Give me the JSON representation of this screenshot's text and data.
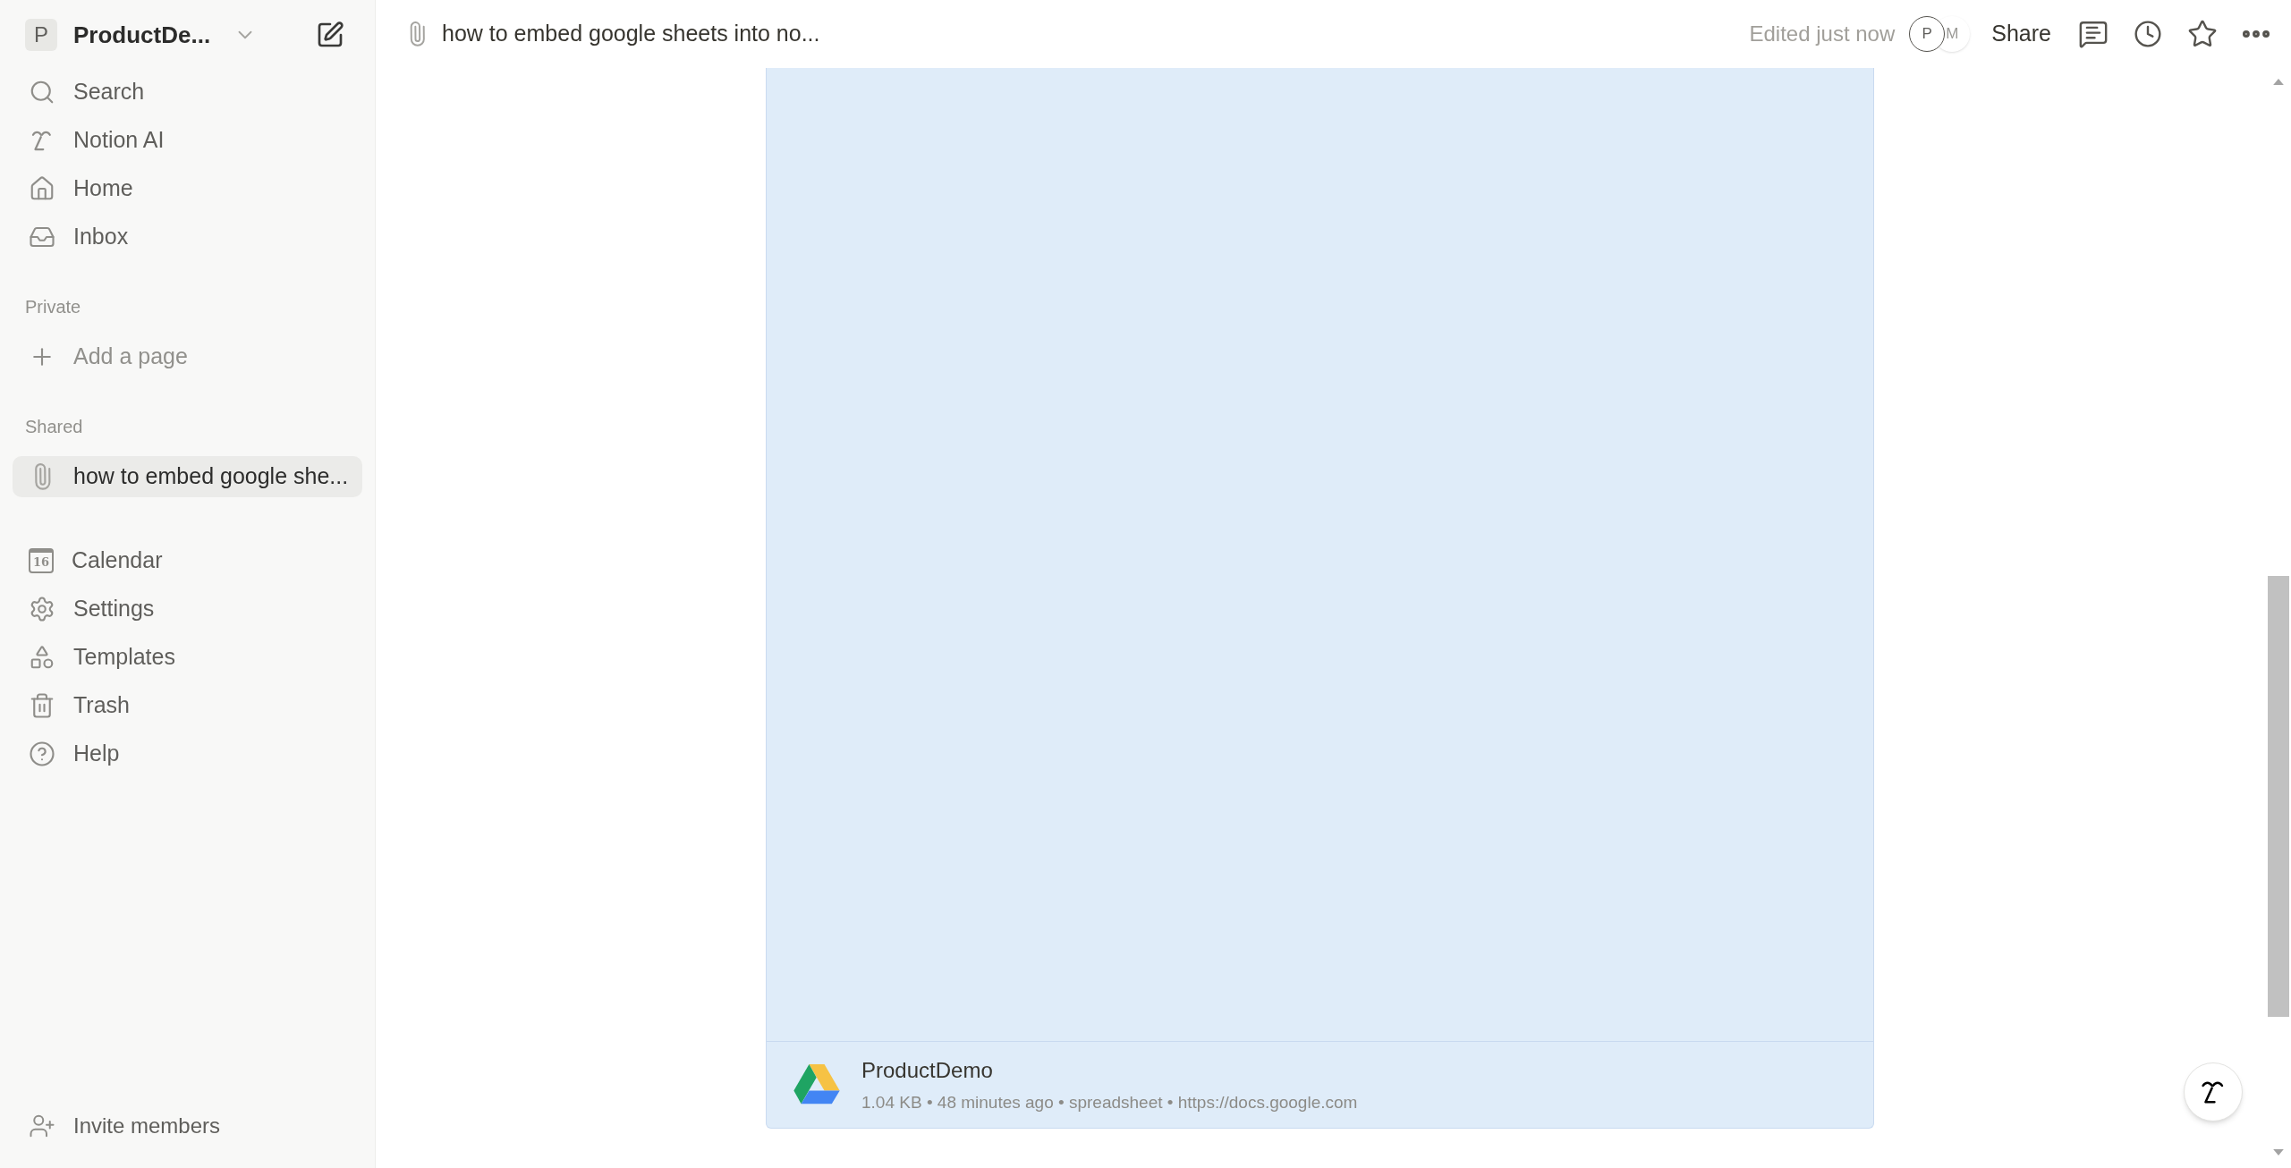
{
  "workspace": {
    "initial": "P",
    "name": "ProductDe..."
  },
  "nav": [
    {
      "label": "Search",
      "kind": "search"
    },
    {
      "label": "Notion AI",
      "kind": "ai"
    },
    {
      "label": "Home",
      "kind": "home"
    },
    {
      "label": "Inbox",
      "kind": "inbox"
    }
  ],
  "sections": [
    {
      "title": "Private",
      "items": [
        {
          "label": "Add a page",
          "kind": "add",
          "selected": false
        }
      ]
    },
    {
      "title": "Shared",
      "items": [
        {
          "label": "how to embed google she...",
          "kind": "page",
          "selected": true
        }
      ]
    }
  ],
  "tools": [
    {
      "label": "Calendar",
      "kind": "calendar",
      "icon_text": "16"
    },
    {
      "label": "Settings",
      "kind": "settings"
    },
    {
      "label": "Templates",
      "kind": "templates"
    },
    {
      "label": "Trash",
      "kind": "trash"
    },
    {
      "label": "Help",
      "kind": "help"
    }
  ],
  "invite": {
    "label": "Invite members"
  },
  "topbar": {
    "breadcrumb": "how to embed google sheets into no...",
    "edited": "Edited just now",
    "avatars": [
      "P",
      "M"
    ],
    "share": "Share"
  },
  "embed": {
    "name": "ProductDemo",
    "meta": "1.04 KB • 48 minutes ago • spreadsheet • https://docs.google.com"
  }
}
